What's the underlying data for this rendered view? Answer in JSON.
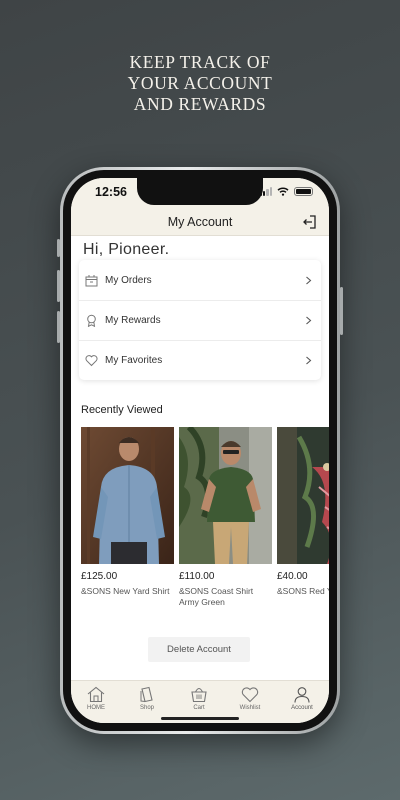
{
  "promo": {
    "line1": "KEEP TRACK OF",
    "line2": "YOUR ACCOUNT",
    "line3": "AND REWARDS"
  },
  "status_bar": {
    "time": "12:56"
  },
  "nav": {
    "title": "My Account",
    "logout_icon": "logout-icon"
  },
  "greeting": "Hi, Pioneer.",
  "menu": [
    {
      "label": "My Orders",
      "icon": "orders-icon"
    },
    {
      "label": "My Rewards",
      "icon": "rewards-icon"
    },
    {
      "label": "My Favorites",
      "icon": "heart-icon"
    }
  ],
  "recently_viewed": {
    "title": "Recently Viewed",
    "items": [
      {
        "price": "£125.00",
        "name": "&SONS New Yard Shirt"
      },
      {
        "price": "£110.00",
        "name": "&SONS Coast Shirt Army Green"
      },
      {
        "price": "£40.00",
        "name": "&SONS Red Y scarf"
      }
    ]
  },
  "delete_account": "Delete Account",
  "tabs": [
    {
      "label": "HOME",
      "icon": "home-icon"
    },
    {
      "label": "Shop",
      "icon": "shop-icon"
    },
    {
      "label": "Cart",
      "icon": "cart-icon"
    },
    {
      "label": "Wishlist",
      "icon": "heart-icon"
    },
    {
      "label": "Account",
      "icon": "person-icon"
    }
  ],
  "colors": {
    "header_bg": "#f4f1e8",
    "background": "#4a5254",
    "accent": "#222222"
  }
}
